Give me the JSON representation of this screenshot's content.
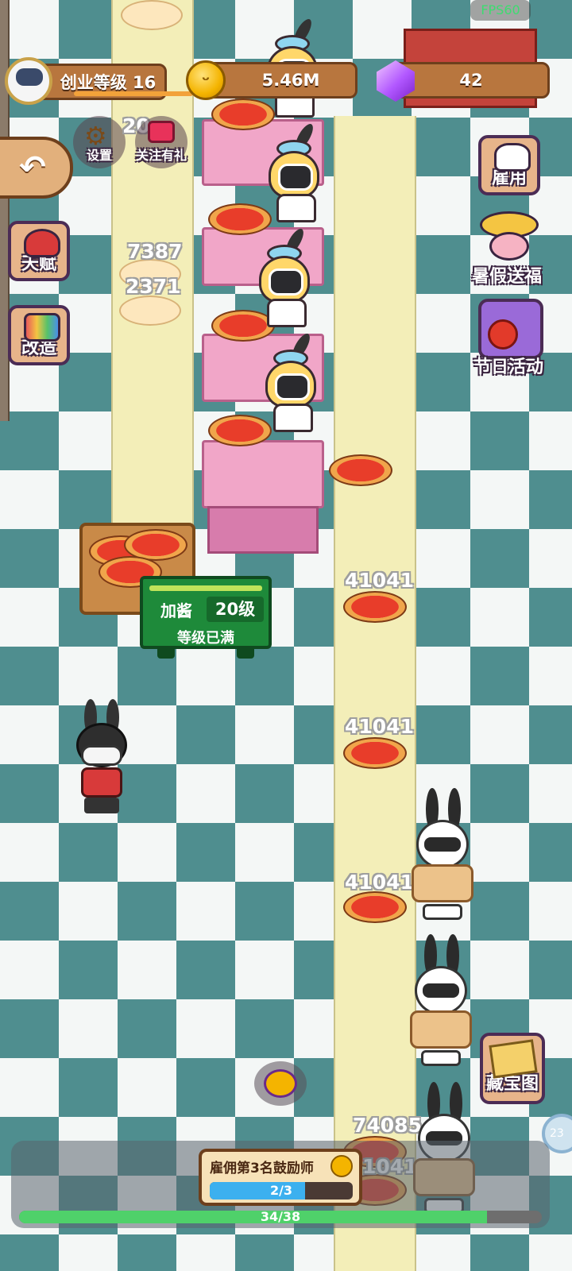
{
  "hud": {
    "level_label": "创业等级 16",
    "coins": "5.46M",
    "gems": "42",
    "fps": "FPS60"
  },
  "top_icons": {
    "settings": "设置",
    "follow_gift": "关注有礼"
  },
  "left_menu": {
    "talent": "天赋",
    "remodel": "改造"
  },
  "right_menu": {
    "hire": "雇用",
    "summer_gift": "暑假送福",
    "festival": "节日活动",
    "treasure_map": "藏宝图"
  },
  "floating_numbers": {
    "dough_partial": "20",
    "dough_1": "7387",
    "dough_2": "2371",
    "pizza_1": "41041",
    "pizza_2": "41041",
    "pizza_3": "41041",
    "pizza_4": "74085",
    "pizza_5_partial": "1041"
  },
  "upgrade_station": {
    "name": "加酱",
    "level": "20级",
    "status": "等级已满"
  },
  "task": {
    "title": "雇佣第3名鼓励师",
    "progress_text": "2/3",
    "progress": 0.667
  },
  "overall_progress": {
    "text": "34/38",
    "progress": 0.895
  },
  "edge_dial": "23",
  "colors": {
    "floor_teal": "#4f8e8f",
    "lane": "#f3eeb8",
    "counter_pink": "#f1a6c8",
    "upgrade_green": "#1e8a3a",
    "progress_green": "#4fd16a",
    "task_blue": "#3cb0ef"
  }
}
